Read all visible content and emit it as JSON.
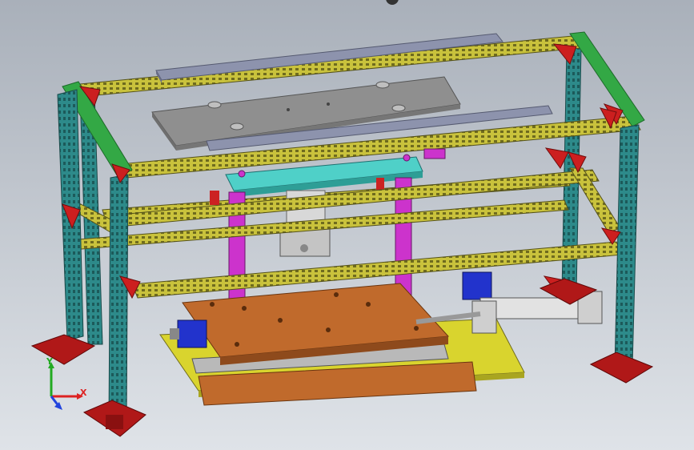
{
  "scene": {
    "colors": {
      "background_top": "#a9b0ba",
      "background_bottom": "#dfe3e8",
      "frame_post": "#2d8a8a",
      "frame_rail": "#c9c23c",
      "frame_top_rail": "#33a845",
      "bracket": "#cc1f1f",
      "foot": "#b01818",
      "guide_rail": "#8d93ad",
      "top_plate": "#8f8f8f",
      "crossbar": "#4fd0c8",
      "guide_post": "#cc33cc",
      "cylinder": "#d8d8d8",
      "mold_plate": "#c06a2c",
      "base_plate": "#d9d42e",
      "motor": "#2233cc",
      "linear_rail": "#b9b9b9"
    },
    "triad": {
      "x_label": "X",
      "y_label": "Y",
      "x_color": "#dd2222",
      "y_color": "#22aa22",
      "z_color": "#2244dd"
    }
  }
}
